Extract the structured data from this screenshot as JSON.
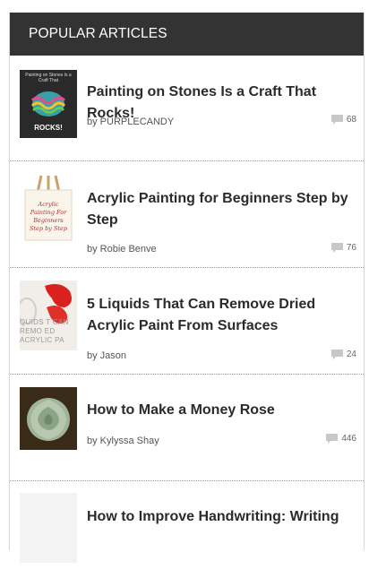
{
  "widget": {
    "title": "POPULAR ARTICLES"
  },
  "articles": [
    {
      "title": "Painting on Stones Is a Craft That Rocks!",
      "byline": "by PURPLECANDY",
      "comments": "68",
      "thumb_text_top": "Painting on Stones Is a Craft That",
      "thumb_text_bottom": "ROCKS!",
      "thumb_icon": "painted-stone-image"
    },
    {
      "title": "Acrylic Painting for Beginners Step by Step",
      "byline": "by Robie Benve",
      "comments": "76",
      "thumb_text": "Acrylic Painting For Beginners Step by Step",
      "thumb_icon": "easel-canvas-image"
    },
    {
      "title": "5 Liquids That Can Remove Dried Acrylic Paint From Surfaces",
      "byline": "by Jason",
      "comments": "24",
      "thumb_text": "QUIDS T CAN REMO ED ACRYLIC PA",
      "thumb_icon": "red-paint-image"
    },
    {
      "title": "How to Make a Money Rose",
      "byline": "by Kylyssa Shay",
      "comments": "446",
      "thumb_icon": "money-rose-image"
    },
    {
      "title": "How to Improve Handwriting: Writing",
      "thumb_icon": "handwriting-image"
    }
  ],
  "colors": {
    "header_bg": "#333333",
    "header_text": "#ffffff",
    "title_text": "#2b2b2b",
    "divider": "#9a9a9a"
  }
}
